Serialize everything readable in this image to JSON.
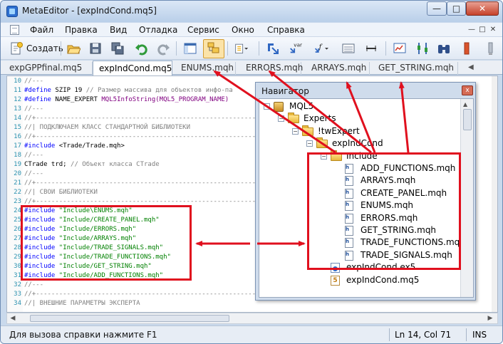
{
  "window": {
    "title": "MetaEditor - [expIndCond.mq5]",
    "minimize": "—",
    "maximize": "□",
    "close": "✕"
  },
  "menu": {
    "items": [
      "Файл",
      "Правка",
      "Вид",
      "Отладка",
      "Сервис",
      "Окно",
      "Справка"
    ],
    "mdi_min": "—",
    "mdi_max": "□",
    "mdi_close": "✕"
  },
  "toolbar": {
    "create_label": "Создать",
    "var_label": "var",
    "f_label": "f"
  },
  "tabs": [
    "expGPPfinal.mq5",
    "expIndCond.mq5",
    "ENUMS.mqh",
    "ERRORS.mqh",
    "ARRAYS.mqh",
    "GET_STRING.mqh"
  ],
  "tab_scroll": "◀",
  "editor": {
    "lines": [
      {
        "n": "10",
        "parts": [
          {
            "t": "//---",
            "c": "comment"
          }
        ]
      },
      {
        "n": "11",
        "parts": [
          {
            "t": "#define",
            "c": "kw"
          },
          {
            "t": " SZIP 19 ",
            "c": ""
          },
          {
            "t": "// Размер массива для объектов инфо-па",
            "c": "comment"
          }
        ]
      },
      {
        "n": "12",
        "parts": [
          {
            "t": "#define",
            "c": "kw"
          },
          {
            "t": " NAME_EXPERT ",
            "c": ""
          },
          {
            "t": "MQL5InfoString(MQL5_PROGRAM_NAME)",
            "c": "purple"
          }
        ]
      },
      {
        "n": "13",
        "parts": [
          {
            "t": "//---",
            "c": "comment"
          }
        ]
      },
      {
        "n": "14",
        "parts": [
          {
            "t": "//+------------------------------------------------------------------",
            "c": "comment"
          }
        ]
      },
      {
        "n": "15",
        "parts": [
          {
            "t": "//| ПОДКЛЮЧАЕМ КЛАСС СТАНДАРТНОЙ БИБЛИОТЕКИ",
            "c": "comment"
          }
        ]
      },
      {
        "n": "16",
        "parts": [
          {
            "t": "//+------------------------------------------------------------------",
            "c": "comment"
          }
        ]
      },
      {
        "n": "17",
        "parts": [
          {
            "t": "#include",
            "c": "kw"
          },
          {
            "t": " <Trade/Trade.mqh>",
            "c": ""
          }
        ]
      },
      {
        "n": "18",
        "parts": [
          {
            "t": "//---",
            "c": "comment"
          }
        ]
      },
      {
        "n": "19",
        "parts": [
          {
            "t": "CTrade trd; ",
            "c": ""
          },
          {
            "t": "// Объект класса CTrade",
            "c": "comment"
          }
        ]
      },
      {
        "n": "20",
        "parts": [
          {
            "t": "//---",
            "c": "comment"
          }
        ]
      },
      {
        "n": "21",
        "parts": [
          {
            "t": "//+------------------------------------------------------------------",
            "c": "comment"
          }
        ]
      },
      {
        "n": "22",
        "parts": [
          {
            "t": "//| СВОИ БИБЛИОТЕКИ",
            "c": "comment"
          }
        ]
      },
      {
        "n": "23",
        "parts": [
          {
            "t": "//+------------------------------------------------------------------",
            "c": "comment"
          }
        ]
      },
      {
        "n": "24",
        "parts": [
          {
            "t": "#include",
            "c": "kw"
          },
          {
            "t": " \"Include\\ENUMS.mqh\"",
            "c": "str"
          }
        ]
      },
      {
        "n": "25",
        "parts": [
          {
            "t": "#include",
            "c": "kw"
          },
          {
            "t": " \"Include/CREATE_PANEL.mqh\"",
            "c": "str"
          }
        ]
      },
      {
        "n": "26",
        "parts": [
          {
            "t": "#include",
            "c": "kw"
          },
          {
            "t": " \"Include/ERRORS.mqh\"",
            "c": "str"
          }
        ]
      },
      {
        "n": "27",
        "parts": [
          {
            "t": "#include",
            "c": "kw"
          },
          {
            "t": " \"Include/ARRAYS.mqh\"",
            "c": "str"
          }
        ]
      },
      {
        "n": "28",
        "parts": [
          {
            "t": "#include",
            "c": "kw"
          },
          {
            "t": " \"Include/TRADE_SIGNALS.mqh\"",
            "c": "str"
          }
        ]
      },
      {
        "n": "29",
        "parts": [
          {
            "t": "#include",
            "c": "kw"
          },
          {
            "t": " \"Include/TRADE_FUNCTIONS.mqh\"",
            "c": "str"
          }
        ]
      },
      {
        "n": "30",
        "parts": [
          {
            "t": "#include",
            "c": "kw"
          },
          {
            "t": " \"Include/GET_STRING.mqh\"",
            "c": "str"
          }
        ]
      },
      {
        "n": "31",
        "parts": [
          {
            "t": "#include",
            "c": "kw"
          },
          {
            "t": " \"Include/ADD_FUNCTIONS.mqh\"",
            "c": "str"
          }
        ]
      },
      {
        "n": "32",
        "parts": [
          {
            "t": "//---",
            "c": "comment"
          }
        ]
      },
      {
        "n": "33",
        "parts": [
          {
            "t": "//+------------------------------------------------------------------",
            "c": "comment"
          }
        ]
      },
      {
        "n": "34",
        "parts": [
          {
            "t": "//| ВНЕШНИЕ ПАРАМЕТРЫ ЭКСПЕРТА",
            "c": "comment"
          }
        ]
      }
    ]
  },
  "navigator": {
    "title": "Навигатор",
    "close": "x",
    "tree": [
      {
        "label": "MQL5",
        "kind": "mql",
        "level": 0
      },
      {
        "label": "Experts",
        "kind": "folder",
        "level": 1
      },
      {
        "label": "!twExpert",
        "kind": "folder",
        "level": 2
      },
      {
        "label": "expIndCond",
        "kind": "folder",
        "level": 3
      },
      {
        "label": "Include",
        "kind": "folder",
        "level": 4
      },
      {
        "label": "ADD_FUNCTIONS.mqh",
        "kind": "h",
        "level": 5
      },
      {
        "label": "ARRAYS.mqh",
        "kind": "h",
        "level": 5
      },
      {
        "label": "CREATE_PANEL.mqh",
        "kind": "h",
        "level": 5
      },
      {
        "label": "ENUMS.mqh",
        "kind": "h",
        "level": 5
      },
      {
        "label": "ERRORS.mqh",
        "kind": "h",
        "level": 5
      },
      {
        "label": "GET_STRING.mqh",
        "kind": "h",
        "level": 5
      },
      {
        "label": "TRADE_FUNCTIONS.mqh",
        "kind": "h",
        "level": 5
      },
      {
        "label": "TRADE_SIGNALS.mqh",
        "kind": "h",
        "level": 5
      },
      {
        "label": "expIndCond.ex5",
        "kind": "ex5",
        "level": 4
      },
      {
        "label": "expIndCond.mq5",
        "kind": "mq5",
        "level": 4
      }
    ]
  },
  "status": {
    "help": "Для вызова справки нажмите F1",
    "position": "Ln 14, Col 71",
    "mode": "INS"
  },
  "colors": {
    "annotation": "#e0101e",
    "keyword": "#0000ff",
    "string": "#008000",
    "comment": "#808080"
  }
}
